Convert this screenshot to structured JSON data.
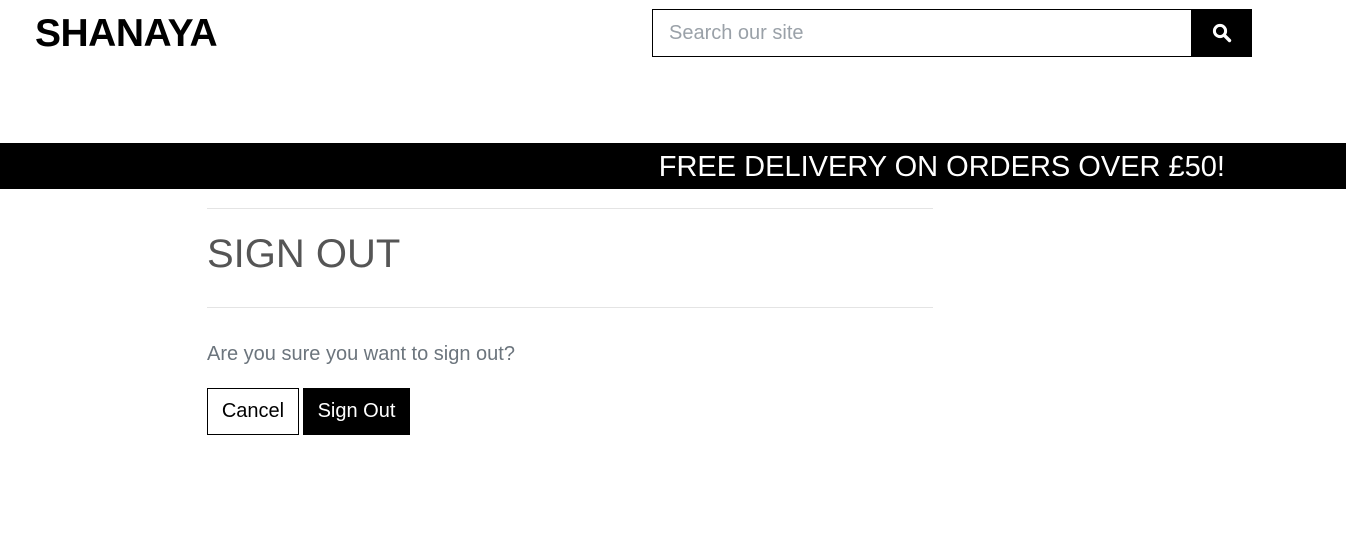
{
  "header": {
    "logo_text": "SHANAYA"
  },
  "search": {
    "placeholder": "Search our site",
    "value": "",
    "button_icon": "search-icon"
  },
  "banner": {
    "text": "FREE DELIVERY ON ORDERS OVER £50!"
  },
  "main": {
    "title": "SIGN OUT",
    "message": "Are you sure you want to sign out?",
    "cancel_label": "Cancel",
    "signout_label": "Sign Out"
  },
  "colors": {
    "banner_bg": "#000000",
    "primary_button": "#000000",
    "title_text": "#555555",
    "muted_text": "#6c757d"
  }
}
